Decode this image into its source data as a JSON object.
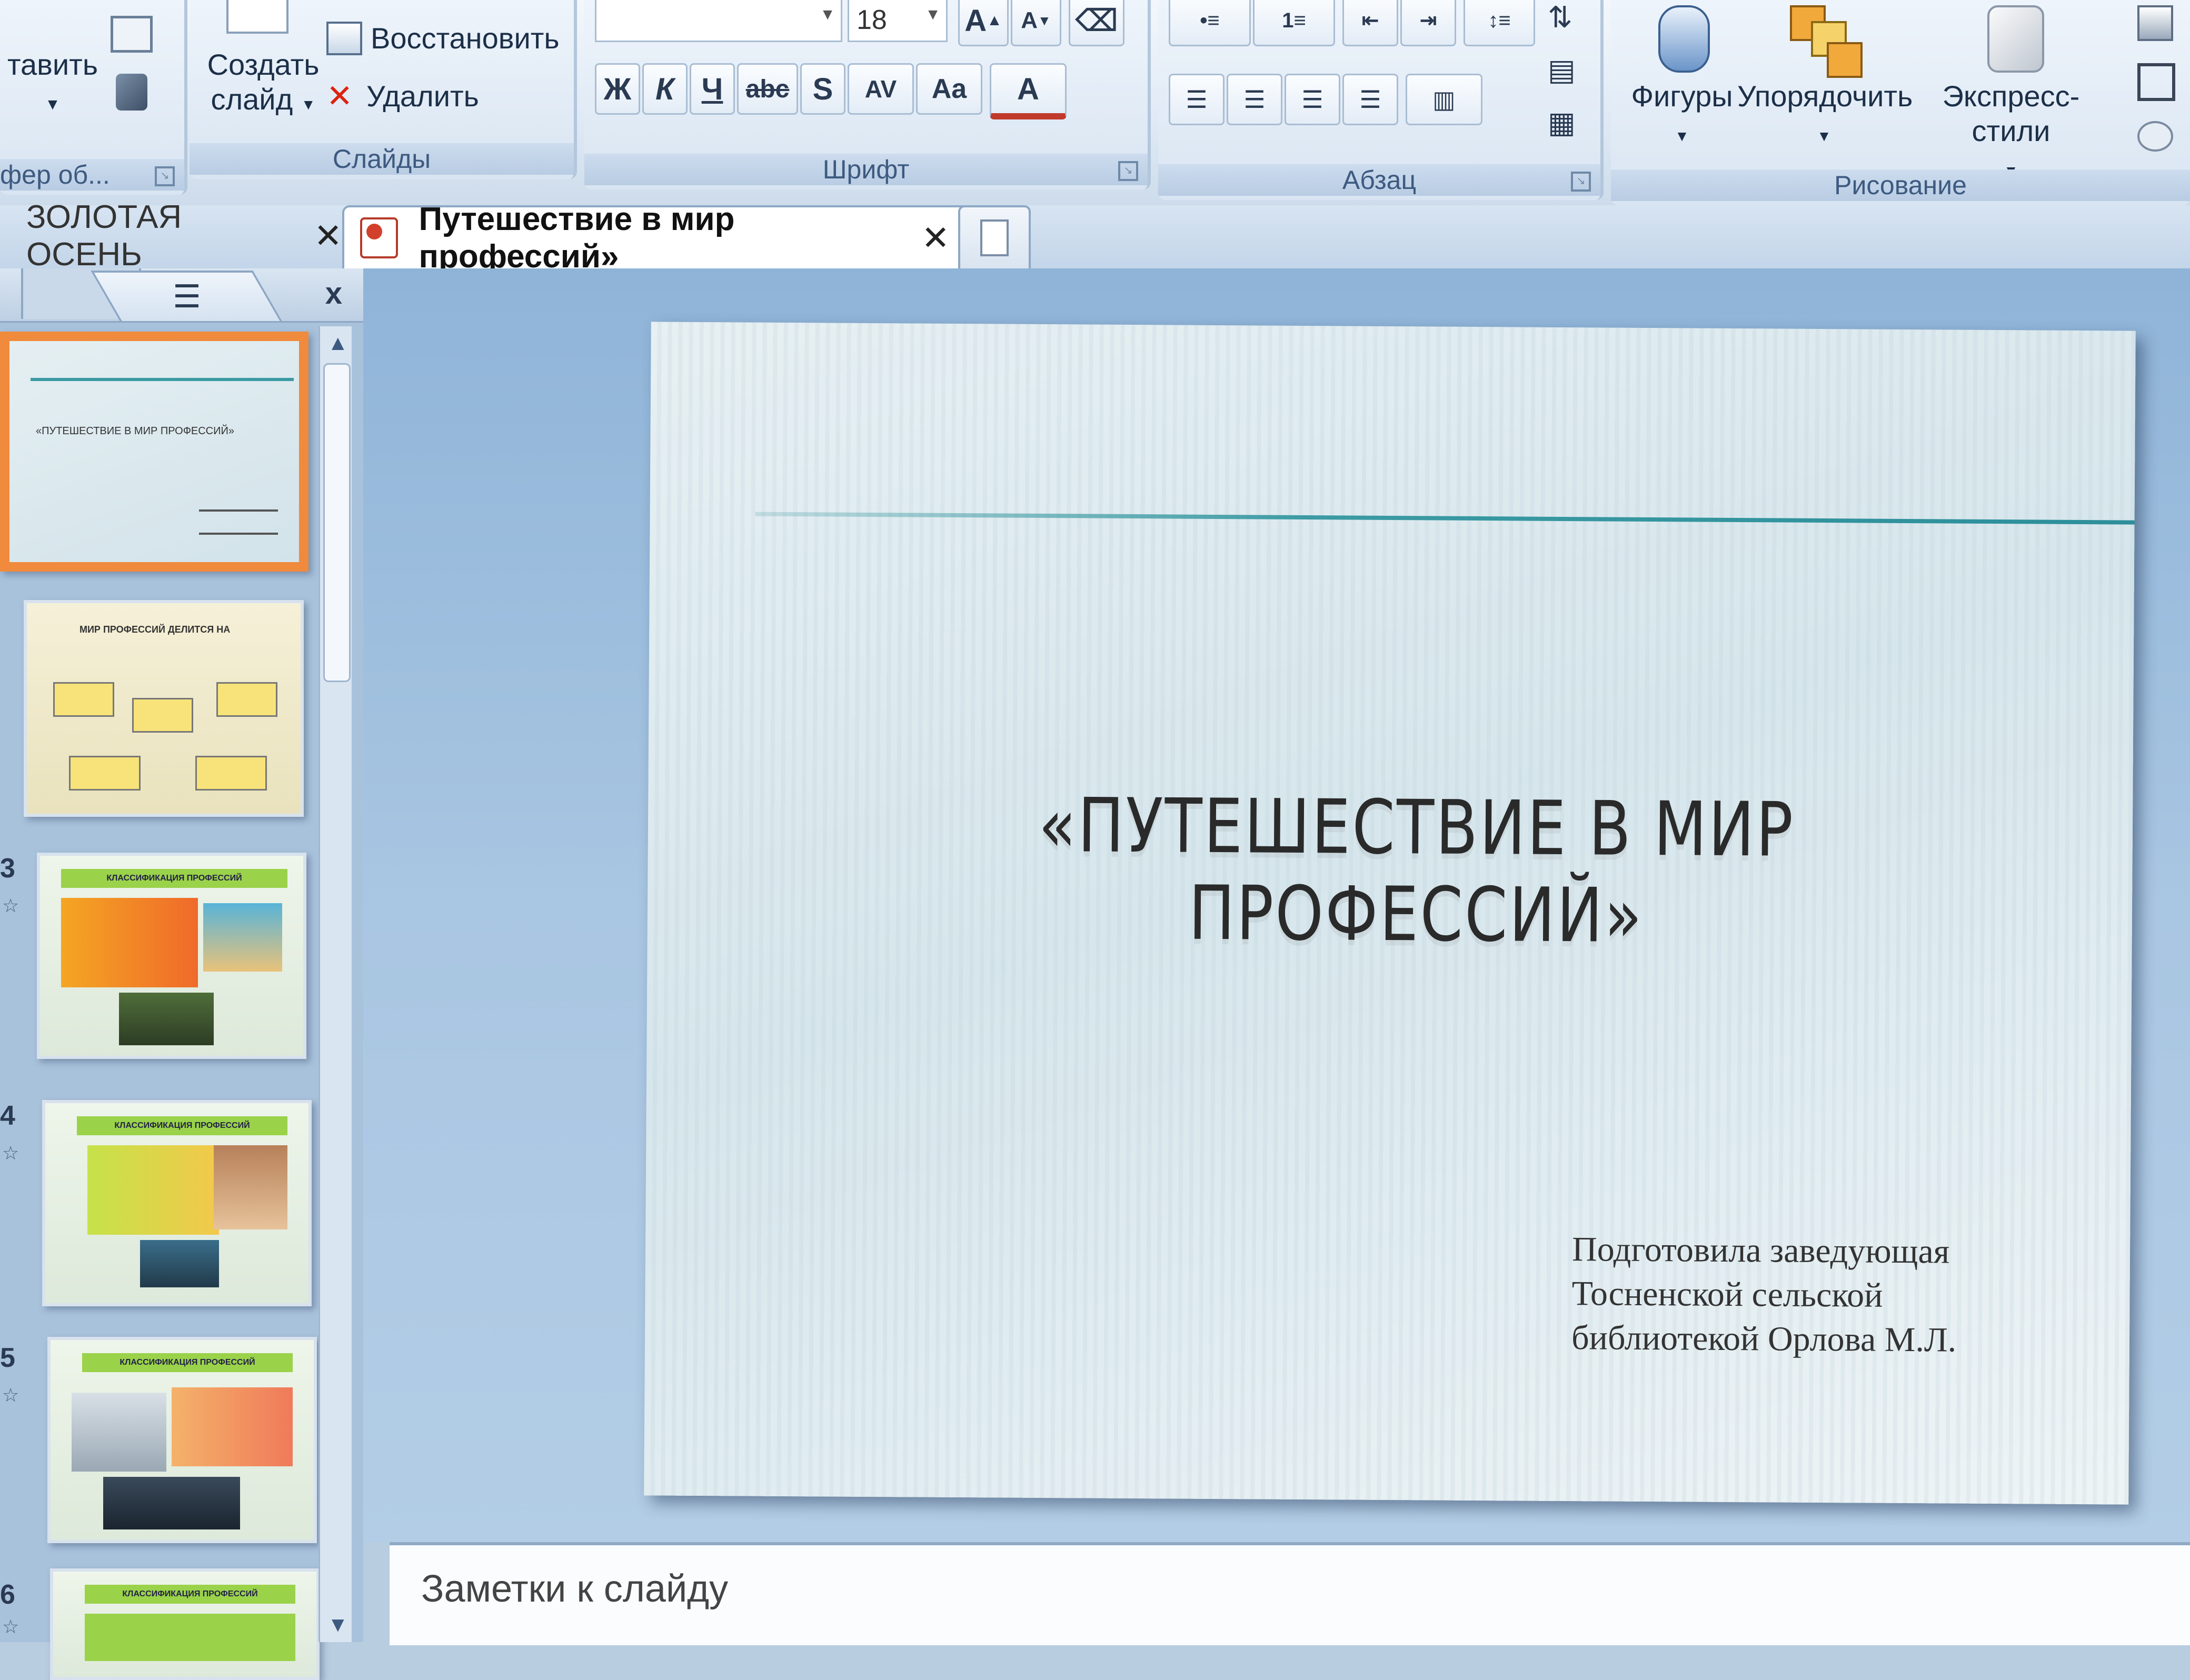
{
  "ribbon": {
    "clipboard": {
      "paste_label": "тавить",
      "group_label": "фер об..."
    },
    "slides": {
      "new_slide_label_1": "Создать",
      "new_slide_label_2": "слайд",
      "reset_label": "Восстановить",
      "delete_label": "Удалить",
      "group_label": "Слайды"
    },
    "font": {
      "size": "18",
      "grow_label": "A",
      "shrink_label": "A",
      "bold": "Ж",
      "italic": "К",
      "underline": "Ч",
      "strike": "abc",
      "shadow": "S",
      "spacing": "AV",
      "case": "Aa",
      "color": "A",
      "group_label": "Шрифт"
    },
    "paragraph": {
      "group_label": "Абзац"
    },
    "drawing": {
      "shapes_label": "Фигуры",
      "arrange_label": "Упорядочить",
      "quick_styles_label": "Экспресс-стили",
      "group_label": "Рисование"
    }
  },
  "tabs": [
    {
      "label": "ЗОЛОТАЯ ОСЕНЬ",
      "close": "✕"
    },
    {
      "label": "Путешествие в мир профессий»",
      "close": "✕"
    }
  ],
  "left_pane": {
    "close": "x",
    "thumbs": [
      {
        "num": "",
        "title": "«ПУТЕШЕСТВИЕ В МИР ПРОФЕССИЙ»"
      },
      {
        "num": "",
        "title": "МИР ПРОФЕССИЙ ДЕЛИТСЯ НА"
      },
      {
        "num": "3",
        "title": "КЛАССИФИКАЦИЯ ПРОФЕССИЙ"
      },
      {
        "num": "4",
        "title": "КЛАССИФИКАЦИЯ ПРОФЕССИЙ"
      },
      {
        "num": "5",
        "title": "КЛАССИФИКАЦИЯ ПРОФЕССИЙ"
      },
      {
        "num": "6",
        "title": "КЛАССИФИКАЦИЯ ПРОФЕССИЙ"
      }
    ]
  },
  "slide": {
    "title": "«ПУТЕШЕСТВИЕ В МИР ПРОФЕССИЙ»",
    "subtitle_line1": "Подготовила заведующая",
    "subtitle_line2": "Тосненской сельской",
    "subtitle_line3": "библиотекой Орлова М.Л."
  },
  "notes": {
    "placeholder": "Заметки к слайду"
  },
  "colors": {
    "accent_teal": "#3b9aa3",
    "selection_orange": "#f08a3c",
    "ribbon_label": "#3d5a80"
  }
}
